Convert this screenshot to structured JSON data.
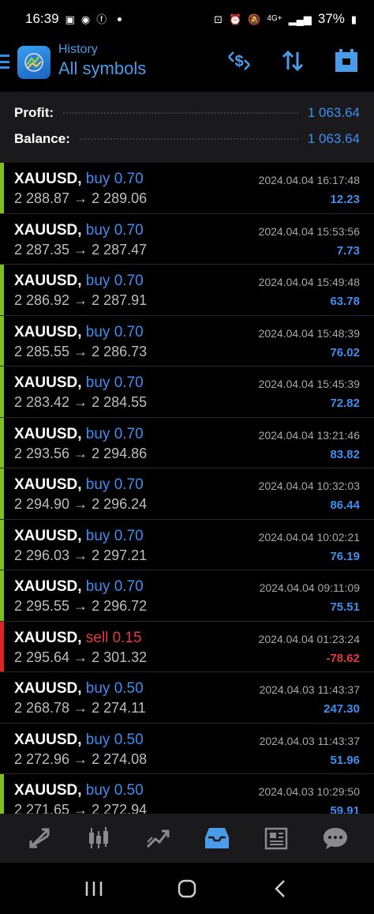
{
  "status_bar": {
    "time": "16:39",
    "battery": "37%",
    "network": "4G+"
  },
  "header": {
    "section": "History",
    "filter": "All symbols",
    "icons": [
      "currency-exchange-icon",
      "sort-icon",
      "calendar-icon"
    ]
  },
  "summary": {
    "profit_label": "Profit:",
    "profit_value": "1 063.64",
    "balance_label": "Balance:",
    "balance_value": "1 063.64"
  },
  "colors": {
    "buy": "#3d8ef0",
    "sell": "#e23b3b",
    "profit_positive": "#3d8ef0",
    "profit_negative": "#e23b3b",
    "bar_buy": "#7fbf1f",
    "bar_sell": "#e02424"
  },
  "trades": [
    {
      "symbol": "XAUUSD,",
      "direction": "buy 0.70",
      "prices": "2 288.87 → 2 289.06",
      "time": "2024.04.04 16:17:48",
      "profit": "12.23",
      "side": "buy",
      "bar": true
    },
    {
      "symbol": "XAUUSD,",
      "direction": "buy 0.70",
      "prices": "2 287.35 → 2 287.47",
      "time": "2024.04.04 15:53:56",
      "profit": "7.73",
      "side": "buy",
      "bar": false
    },
    {
      "symbol": "XAUUSD,",
      "direction": "buy 0.70",
      "prices": "2 286.92 → 2 287.91",
      "time": "2024.04.04 15:49:48",
      "profit": "63.78",
      "side": "buy",
      "bar": true
    },
    {
      "symbol": "XAUUSD,",
      "direction": "buy 0.70",
      "prices": "2 285.55 → 2 286.73",
      "time": "2024.04.04 15:48:39",
      "profit": "76.02",
      "side": "buy",
      "bar": true
    },
    {
      "symbol": "XAUUSD,",
      "direction": "buy 0.70",
      "prices": "2 283.42 → 2 284.55",
      "time": "2024.04.04 15:45:39",
      "profit": "72.82",
      "side": "buy",
      "bar": true
    },
    {
      "symbol": "XAUUSD,",
      "direction": "buy 0.70",
      "prices": "2 293.56 → 2 294.86",
      "time": "2024.04.04 13:21:46",
      "profit": "83.82",
      "side": "buy",
      "bar": true
    },
    {
      "symbol": "XAUUSD,",
      "direction": "buy 0.70",
      "prices": "2 294.90 → 2 296.24",
      "time": "2024.04.04 10:32:03",
      "profit": "86.44",
      "side": "buy",
      "bar": true
    },
    {
      "symbol": "XAUUSD,",
      "direction": "buy 0.70",
      "prices": "2 296.03 → 2 297.21",
      "time": "2024.04.04 10:02:21",
      "profit": "76.19",
      "side": "buy",
      "bar": true
    },
    {
      "symbol": "XAUUSD,",
      "direction": "buy 0.70",
      "prices": "2 295.55 → 2 296.72",
      "time": "2024.04.04 09:11:09",
      "profit": "75.51",
      "side": "buy",
      "bar": true
    },
    {
      "symbol": "XAUUSD,",
      "direction": "sell 0.15",
      "prices": "2 295.64 → 2 301.32",
      "time": "2024.04.04 01:23:24",
      "profit": "-78.62",
      "side": "sell",
      "bar": true
    },
    {
      "symbol": "XAUUSD,",
      "direction": "buy 0.50",
      "prices": "2 268.78 → 2 274.11",
      "time": "2024.04.03 11:43:37",
      "profit": "247.30",
      "side": "buy",
      "bar": false
    },
    {
      "symbol": "XAUUSD,",
      "direction": "buy 0.50",
      "prices": "2 272.96 → 2 274.08",
      "time": "2024.04.03 11:43:37",
      "profit": "51.96",
      "side": "buy",
      "bar": false
    },
    {
      "symbol": "XAUUSD,",
      "direction": "buy 0.50",
      "prices": "2 271.65 → 2 272.94",
      "time": "2024.04.03 10:29:50",
      "profit": "59.91",
      "side": "buy",
      "bar": true
    }
  ],
  "bottom_tabs": [
    "quotes-icon",
    "chart-icon",
    "trade-icon",
    "history-icon",
    "news-icon",
    "chat-icon"
  ],
  "active_tab": "history-icon",
  "nav_bar": [
    "recent-apps-icon",
    "home-icon",
    "back-icon"
  ]
}
